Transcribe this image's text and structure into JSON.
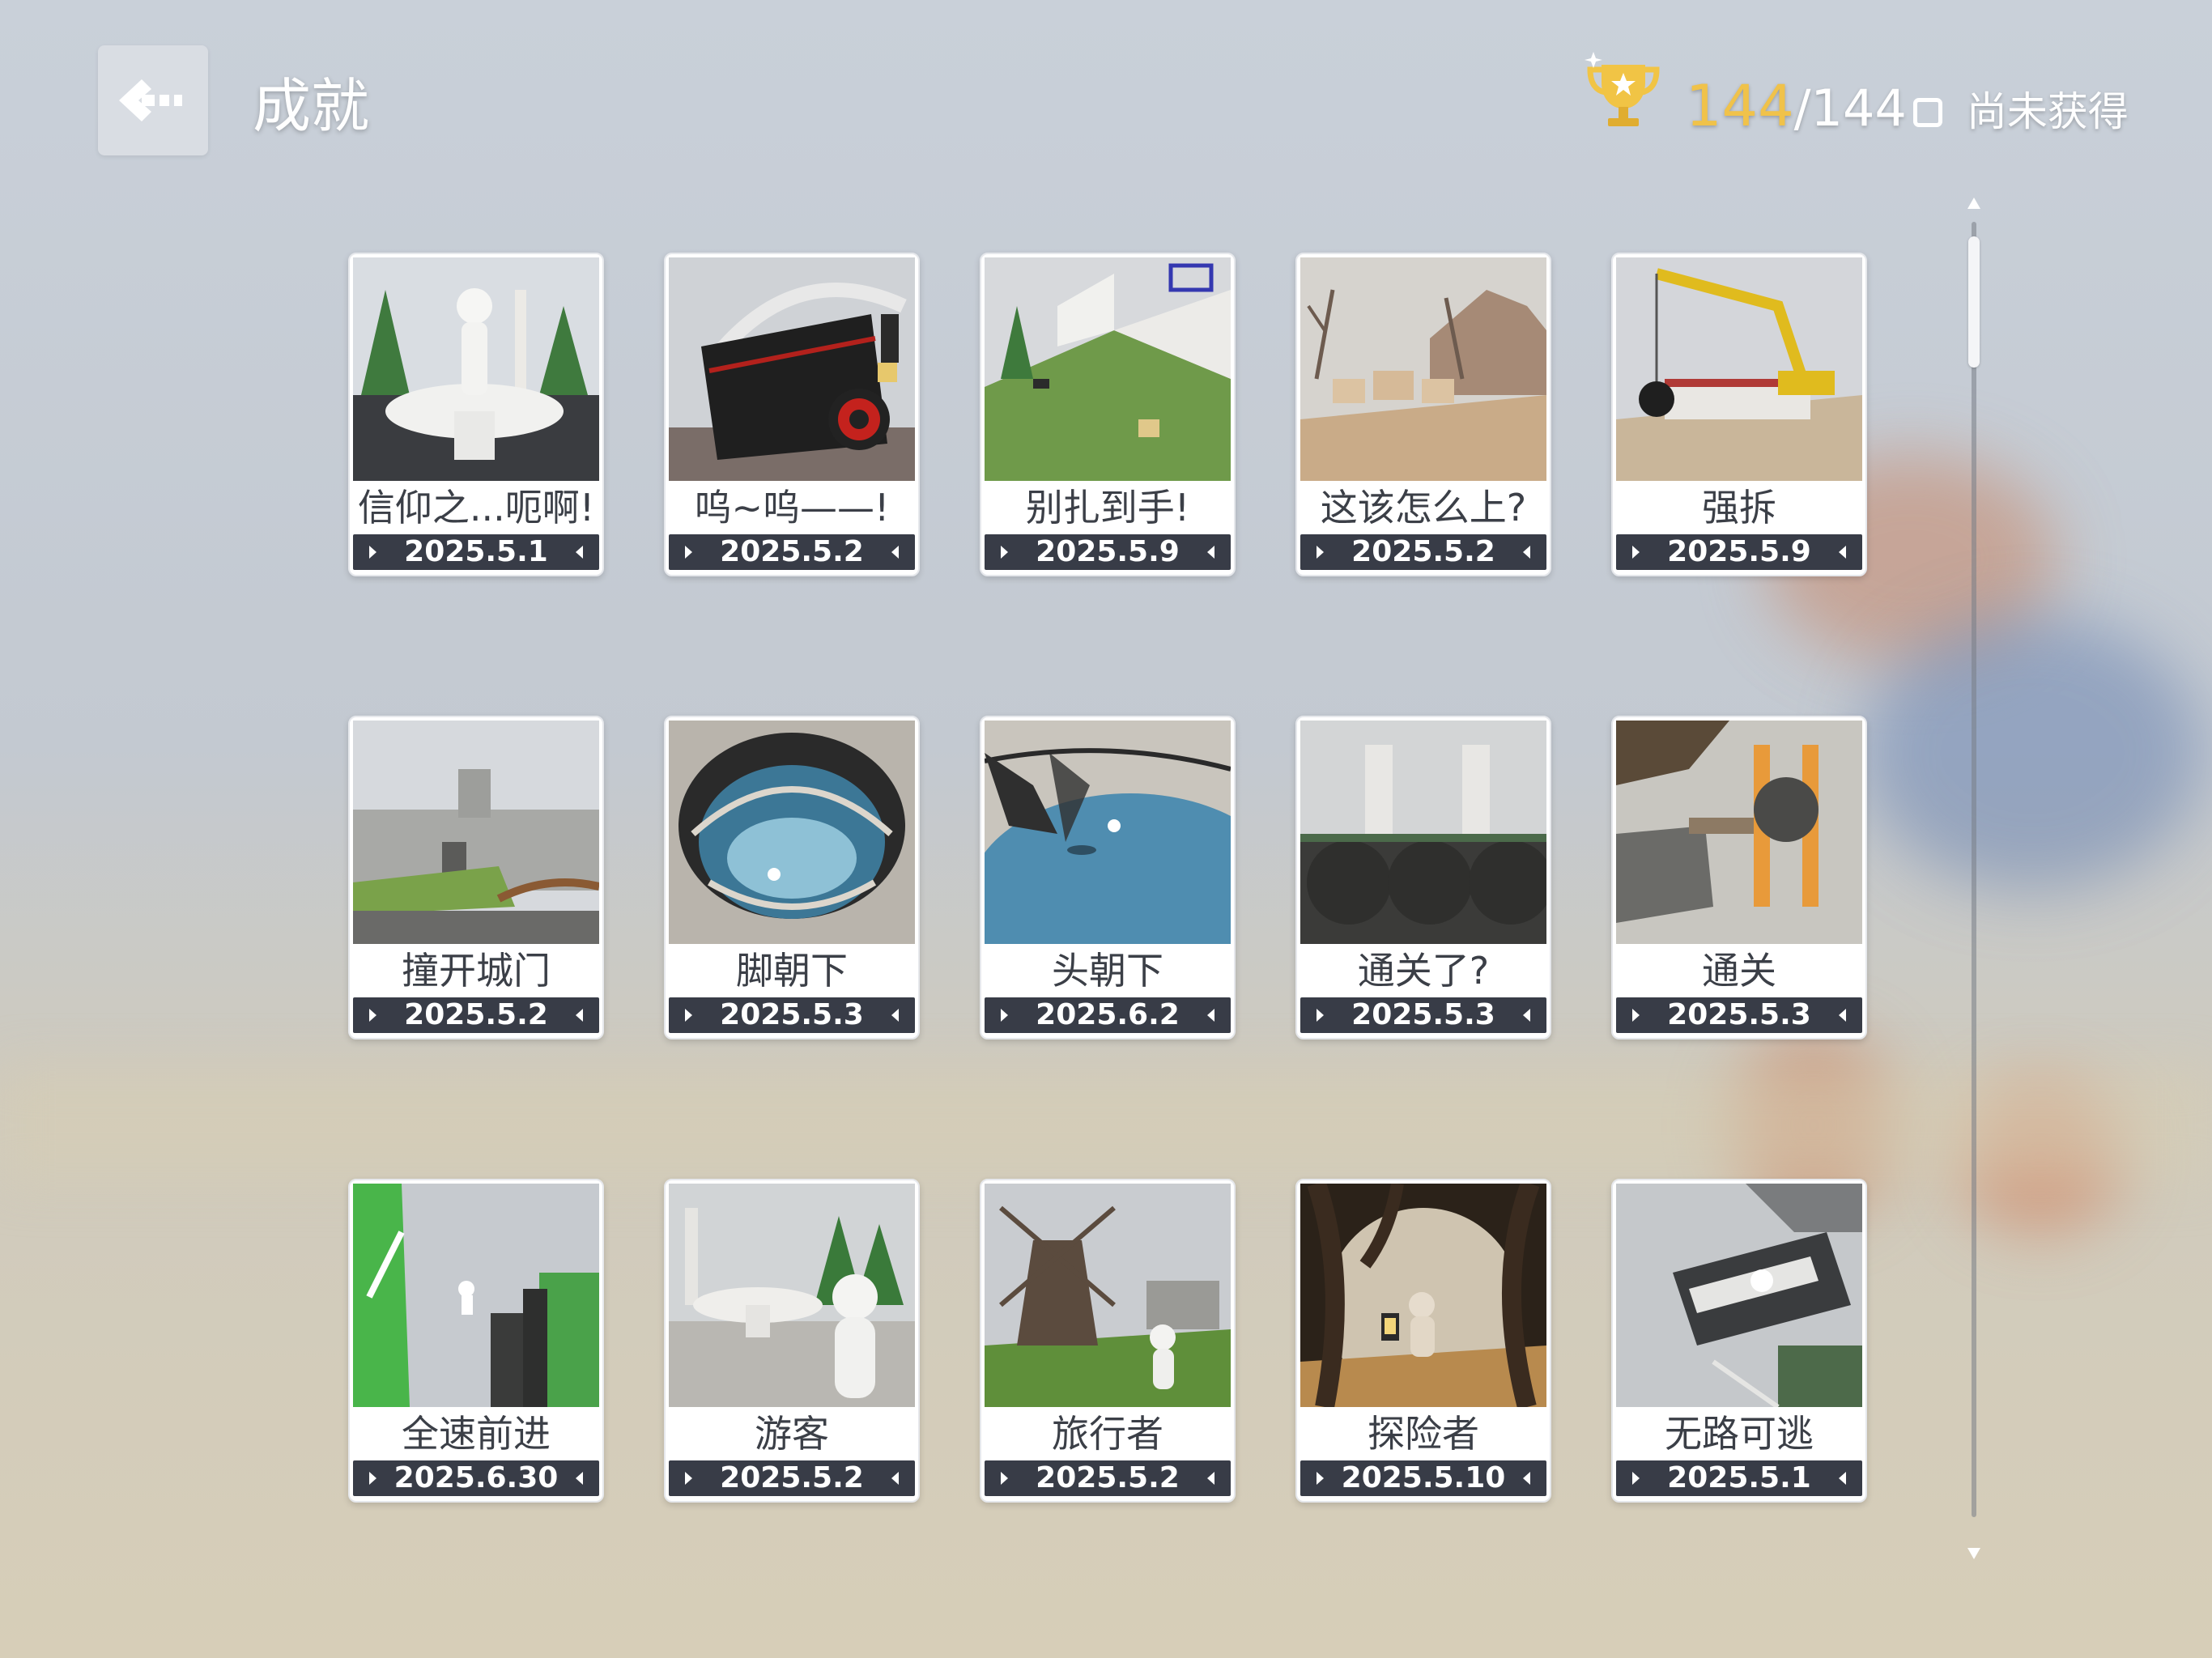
{
  "header": {
    "title": "成就",
    "earned_count": "144",
    "total_count": "/144",
    "filter_label": "尚未获得"
  },
  "colors": {
    "earned_accent": "#f0c24a",
    "date_bar": "#383c47"
  },
  "icons": {
    "back": "back-arrow-icon",
    "trophy": "trophy-icon",
    "checkbox": "checkbox-icon"
  },
  "achievements": [
    {
      "name": "信仰之...呃啊!",
      "date": "2025.5.1"
    },
    {
      "name": "呜~呜——!",
      "date": "2025.5.2"
    },
    {
      "name": "别扎到手!",
      "date": "2025.5.9"
    },
    {
      "name": "这该怎么上?",
      "date": "2025.5.2"
    },
    {
      "name": "强拆",
      "date": "2025.5.9"
    },
    {
      "name": "撞开城门",
      "date": "2025.5.2"
    },
    {
      "name": "脚朝下",
      "date": "2025.5.3"
    },
    {
      "name": "头朝下",
      "date": "2025.6.2"
    },
    {
      "name": "通关了?",
      "date": "2025.5.3"
    },
    {
      "name": "通关",
      "date": "2025.5.3"
    },
    {
      "name": "全速前进",
      "date": "2025.6.30"
    },
    {
      "name": "游客",
      "date": "2025.5.2"
    },
    {
      "name": "旅行者",
      "date": "2025.5.2"
    },
    {
      "name": "探险者",
      "date": "2025.5.10"
    },
    {
      "name": "无路可逃",
      "date": "2025.5.1"
    }
  ]
}
